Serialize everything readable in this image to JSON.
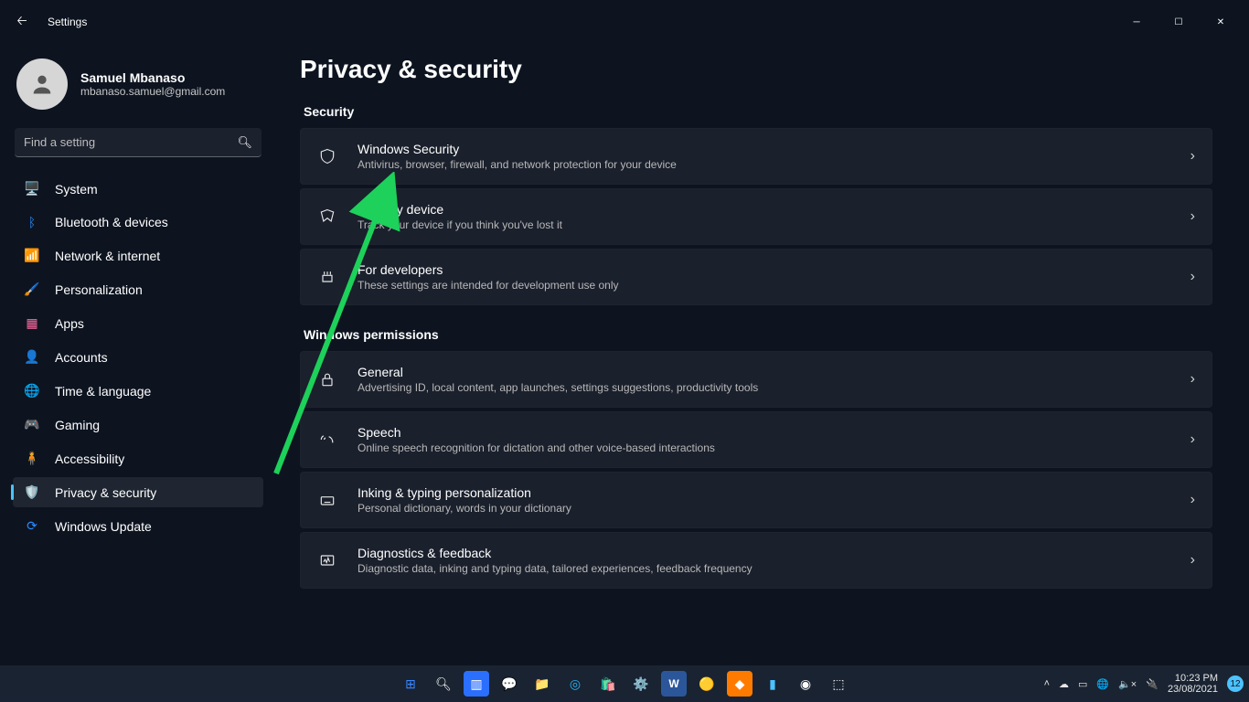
{
  "window": {
    "title": "Settings"
  },
  "profile": {
    "name": "Samuel Mbanaso",
    "email": "mbanaso.samuel@gmail.com"
  },
  "search": {
    "placeholder": "Find a setting"
  },
  "nav": [
    {
      "label": "System"
    },
    {
      "label": "Bluetooth & devices"
    },
    {
      "label": "Network & internet"
    },
    {
      "label": "Personalization"
    },
    {
      "label": "Apps"
    },
    {
      "label": "Accounts"
    },
    {
      "label": "Time & language"
    },
    {
      "label": "Gaming"
    },
    {
      "label": "Accessibility"
    },
    {
      "label": "Privacy & security"
    },
    {
      "label": "Windows Update"
    }
  ],
  "page": {
    "title": "Privacy & security",
    "sections": [
      {
        "heading": "Security",
        "items": [
          {
            "title": "Windows Security",
            "sub": "Antivirus, browser, firewall, and network protection for your device"
          },
          {
            "title": "Find my device",
            "sub": "Track your device if you think you've lost it"
          },
          {
            "title": "For developers",
            "sub": "These settings are intended for development use only"
          }
        ]
      },
      {
        "heading": "Windows permissions",
        "items": [
          {
            "title": "General",
            "sub": "Advertising ID, local content, app launches, settings suggestions, productivity tools"
          },
          {
            "title": "Speech",
            "sub": "Online speech recognition for dictation and other voice-based interactions"
          },
          {
            "title": "Inking & typing personalization",
            "sub": "Personal dictionary, words in your dictionary"
          },
          {
            "title": "Diagnostics & feedback",
            "sub": "Diagnostic data, inking and typing data, tailored experiences, feedback frequency"
          }
        ]
      }
    ]
  },
  "tray": {
    "time": "10:23 PM",
    "date": "23/08/2021",
    "badge": "12"
  }
}
